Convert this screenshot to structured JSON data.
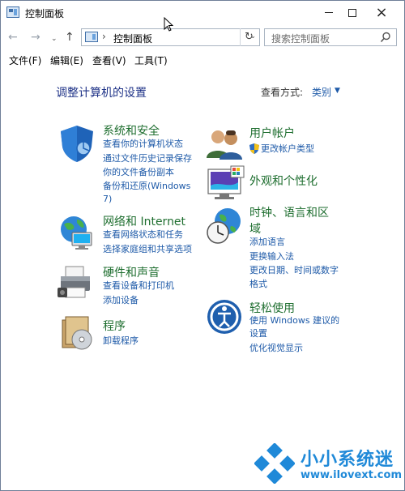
{
  "window": {
    "title": "控制面板"
  },
  "nav": {
    "back": "←",
    "forward": "→",
    "recent": "⌄",
    "up": "↑",
    "address_separator": "›",
    "address": "控制面板",
    "address_dropdown": "⌄",
    "refresh": "↻",
    "search_placeholder": "搜索控制面板"
  },
  "menu": {
    "file": "文件(F)",
    "edit": "编辑(E)",
    "view": "查看(V)",
    "tools": "工具(T)"
  },
  "content": {
    "title": "调整计算机的设置",
    "view_by_label": "查看方式:",
    "view_by_value": "类别",
    "categories": [
      {
        "title": "系统和安全",
        "links": [
          "查看你的计算机状态",
          "通过文件历史记录保存",
          "你的文件备份副本",
          "备份和还原(Windows",
          "7)"
        ]
      },
      {
        "title": "网络和 Internet",
        "links": [
          "查看网络状态和任务",
          "选择家庭组和共享选项"
        ]
      },
      {
        "title": "硬件和声音",
        "links": [
          "查看设备和打印机",
          "添加设备"
        ]
      },
      {
        "title": "程序",
        "links": [
          "卸载程序"
        ]
      },
      {
        "title": "用户帐户",
        "links": [
          "更改帐户类型"
        ]
      },
      {
        "title": "外观和个性化",
        "links": []
      },
      {
        "title": "时钟、语言和区",
        "title2": "域",
        "links": [
          "添加语言",
          "更换输入法",
          "更改日期、时间或数字",
          "格式"
        ]
      },
      {
        "title": "轻松使用",
        "links": [
          "使用 Windows 建议的",
          "设置",
          "优化视觉显示"
        ]
      }
    ]
  },
  "watermark": {
    "name": "小小系统迷",
    "url": "www.ilovext.com"
  },
  "colors": {
    "accent": "#1e5aa8",
    "category_title": "#1e6e2f",
    "heading": "#1e3287",
    "watermark": "#1f89d8"
  }
}
